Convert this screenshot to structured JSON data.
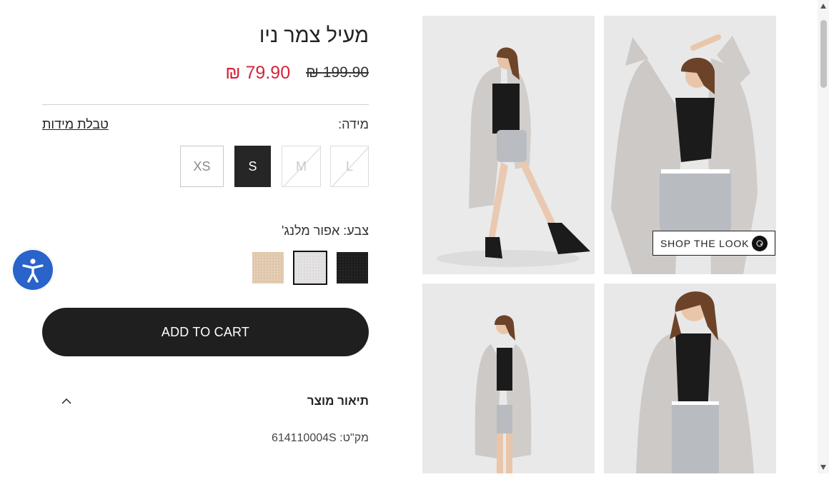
{
  "product": {
    "title": "מעיל צמר ניו",
    "old_price": "199.90 ₪",
    "new_price": "79.90 ₪",
    "sku_line": "מק\"ט: 614110004S"
  },
  "size": {
    "label": "מידה:",
    "chart_link": "טבלת מידות",
    "options": [
      {
        "label": "XS",
        "state": "available"
      },
      {
        "label": "S",
        "state": "selected"
      },
      {
        "label": "M",
        "state": "unavailable"
      },
      {
        "label": "L",
        "state": "unavailable"
      }
    ]
  },
  "color": {
    "label": "צבע: אפור מלנג'",
    "swatches": [
      {
        "name": "beige",
        "hex": "#e3cdb3",
        "selected": false
      },
      {
        "name": "grey melange",
        "hex": "#e4e2e3",
        "selected": true
      },
      {
        "name": "black",
        "hex": "#1d1d1d",
        "selected": false
      }
    ]
  },
  "cart": {
    "label": "ADD TO CART"
  },
  "description": {
    "title": "תיאור מוצר",
    "toggle_icon": "chevron-up-icon"
  },
  "gallery": {
    "shop_look_label": "SHOP THE LOOK",
    "shop_look_icon": "shop-the-look-logo-icon",
    "photos": [
      "coat-side-pose",
      "coat-arms-raised",
      "coat-full-length",
      "coat-closeup"
    ]
  },
  "accessibility": {
    "icon": "accessibility-icon",
    "color": "#2a63c9"
  },
  "colors": {
    "sale": "#d3243b",
    "button": "#1f1f1f"
  }
}
